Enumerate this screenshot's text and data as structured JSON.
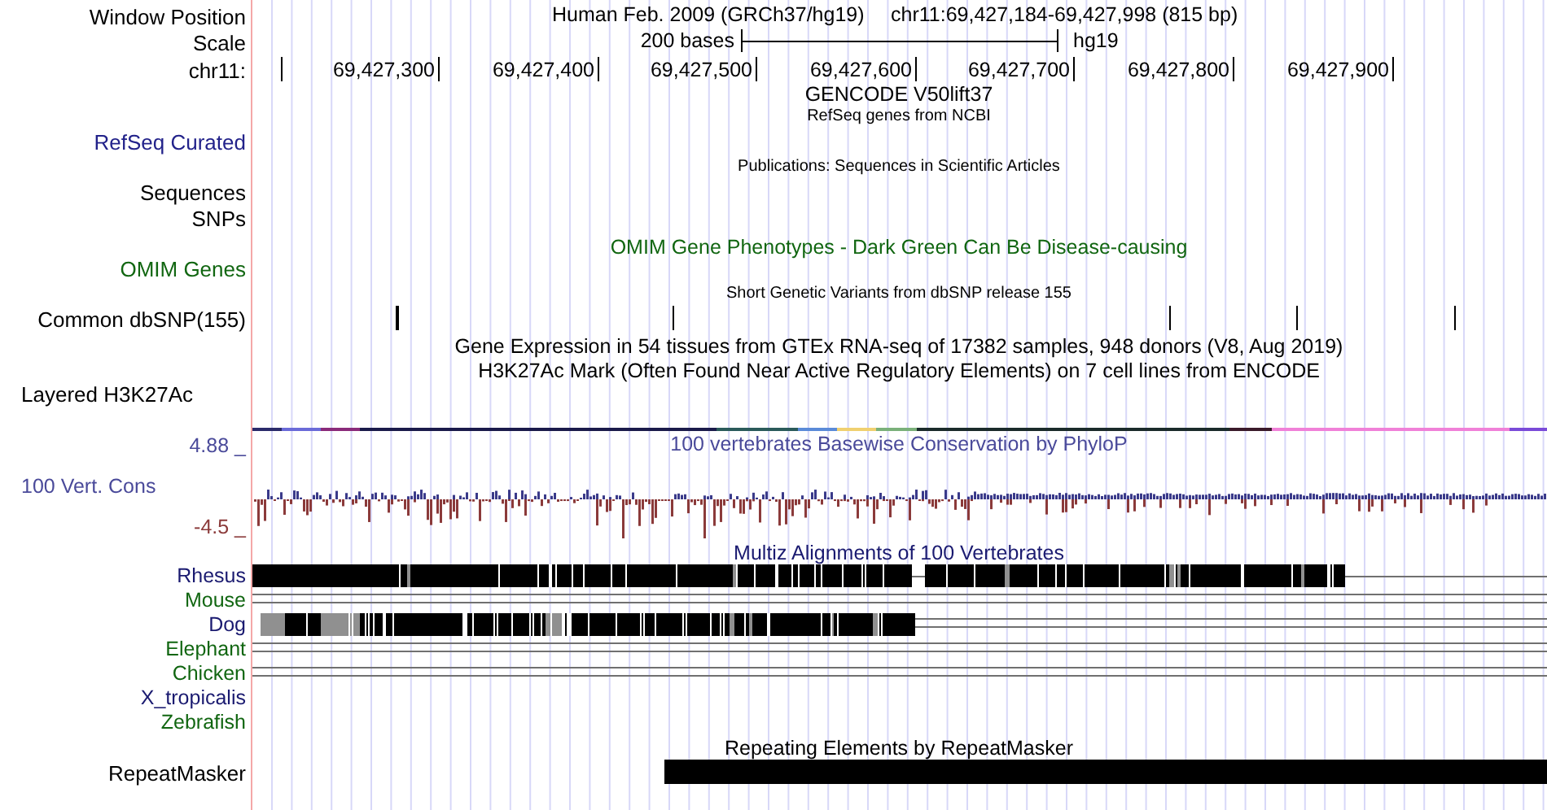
{
  "header": {
    "label": "Window Position",
    "assembly_title": "Human Feb. 2009 (GRCh37/hg19)",
    "position": "chr11:69,427,184-69,427,998 (815 bp)"
  },
  "scale": {
    "label": "Scale",
    "bar_label": "200 bases",
    "assembly": "hg19"
  },
  "ruler": {
    "label": "chr11:",
    "ticks": [
      "69,427,300",
      "69,427,400",
      "69,427,500",
      "69,427,600",
      "69,427,700",
      "69,427,800",
      "69,427,900"
    ]
  },
  "titles": [
    {
      "text": "GENCODE V50lift37",
      "kind": "heading"
    },
    {
      "text": "RefSeq genes from NCBI",
      "kind": "caption"
    },
    {
      "text": "Publications: Sequences in Scientific Articles",
      "kind": "caption"
    },
    {
      "text": "OMIM Gene Phenotypes - Dark Green Can Be Disease-causing",
      "kind": "heading",
      "color": "#116611"
    },
    {
      "text": "Short Genetic Variants from dbSNP release 155",
      "kind": "caption"
    },
    {
      "text": "Gene Expression in 54 tissues from GTEx RNA-seq of 17382 samples, 948 donors (V8, Aug 2019)",
      "kind": "heading"
    },
    {
      "text": "H3K27Ac Mark (Often Found Near Active Regulatory Elements) on 7 cell lines from ENCODE",
      "kind": "heading"
    },
    {
      "text": "100 vertebrates Basewise Conservation by PhyloP",
      "kind": "heading",
      "color": "#4a4a9a"
    },
    {
      "text": "Multiz Alignments of 100 Vertebrates",
      "kind": "heading",
      "color": "#1a1a70"
    },
    {
      "text": "Repeating Elements by RepeatMasker",
      "kind": "heading"
    }
  ],
  "tracks": [
    {
      "label": "RefSeq Curated",
      "color": "#22228a",
      "kind": "plain"
    },
    {
      "label": "Sequences",
      "kind": "plain"
    },
    {
      "label": "SNPs",
      "kind": "plain"
    },
    {
      "label": "OMIM Genes",
      "color": "#116611",
      "kind": "plain"
    },
    {
      "label": "Common dbSNP(155)",
      "kind": "snps"
    },
    {
      "label": "Layered H3K27Ac",
      "kind": "composite"
    }
  ],
  "conservation": {
    "label": "100 Vert. Cons",
    "color": "#4a4a9a",
    "max": {
      "text": "4.88 _",
      "color": "#4a4a9a"
    },
    "min": {
      "text": "-4.5 _",
      "color": "#8b3a3a"
    }
  },
  "alignments": [
    {
      "species": "Rhesus",
      "color": "#1a1a70",
      "kind": "rhesus"
    },
    {
      "species": "Mouse",
      "color": "#116611",
      "kind": "lines"
    },
    {
      "species": "Dog",
      "color": "#1a1a70",
      "kind": "dog"
    },
    {
      "species": "Elephant",
      "color": "#116611",
      "kind": "lines"
    },
    {
      "species": "Chicken",
      "color": "#116611",
      "kind": "lines"
    },
    {
      "species": "X_tropicalis",
      "color": "#1a1a70",
      "kind": "none"
    },
    {
      "species": "Zebrafish",
      "color": "#116611",
      "kind": "none"
    }
  ],
  "repeats": {
    "label": "RepeatMasker"
  }
}
